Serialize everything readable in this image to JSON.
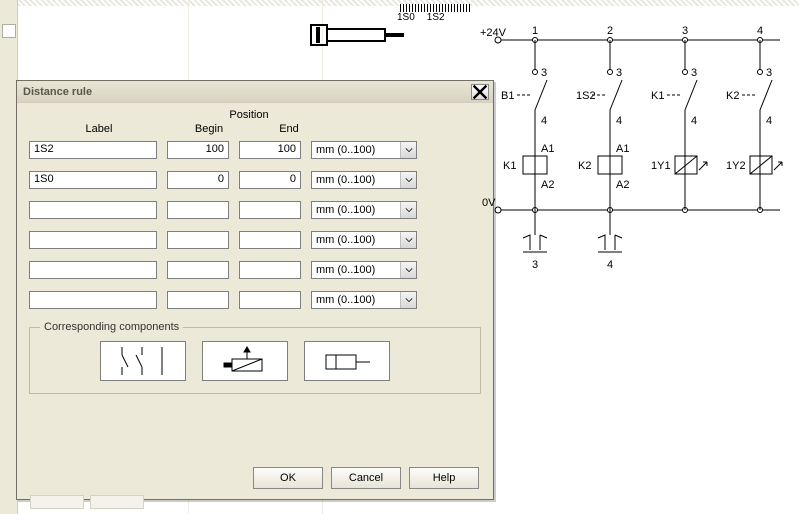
{
  "dialog": {
    "title": "Distance rule",
    "headers": {
      "position": "Position",
      "label": "Label",
      "begin": "Begin",
      "end": "End"
    },
    "rows": [
      {
        "label": "1S2",
        "begin": "100",
        "end": "100",
        "unit": "mm  (0..100)"
      },
      {
        "label": "1S0",
        "begin": "0",
        "end": "0",
        "unit": "mm  (0..100)"
      },
      {
        "label": "",
        "begin": "",
        "end": "",
        "unit": "mm  (0..100)"
      },
      {
        "label": "",
        "begin": "",
        "end": "",
        "unit": "mm  (0..100)"
      },
      {
        "label": "",
        "begin": "",
        "end": "",
        "unit": "mm  (0..100)"
      },
      {
        "label": "",
        "begin": "",
        "end": "",
        "unit": "mm  (0..100)"
      }
    ],
    "corresponding": "Corresponding components",
    "buttons": {
      "ok": "OK",
      "cancel": "Cancel",
      "help": "Help"
    }
  },
  "ruler": {
    "left": "1S0",
    "right": "1S2"
  },
  "circuit": {
    "rail_pos": "+24V",
    "rail_neg": "0V",
    "cols": [
      "1",
      "2",
      "3",
      "4"
    ],
    "switch_labels": [
      "B1",
      "1S2",
      "K1",
      "K2"
    ],
    "node_top": "3",
    "node_bot": "4",
    "coil_top": [
      "A1",
      "A1",
      "",
      ""
    ],
    "coil_names": [
      "K1",
      "K2",
      "1Y1",
      "1Y2"
    ],
    "coil_bot": [
      "A2",
      "A2",
      "",
      ""
    ],
    "footer_nums": [
      "3",
      "4"
    ]
  }
}
